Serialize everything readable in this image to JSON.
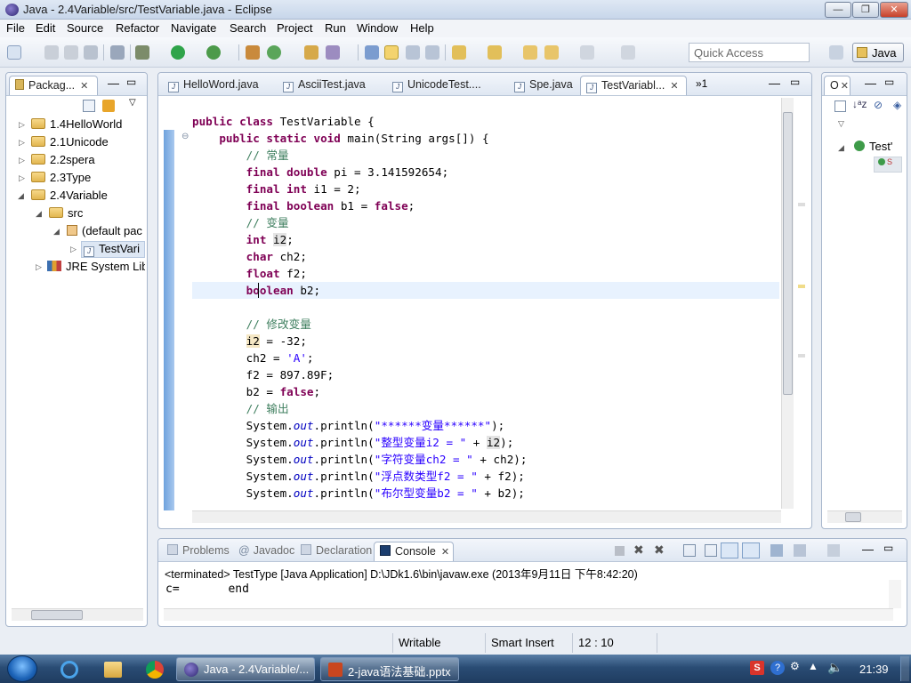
{
  "window": {
    "title": "Java - 2.4Variable/src/TestVariable.java - Eclipse"
  },
  "menu": [
    "File",
    "Edit",
    "Source",
    "Refactor",
    "Navigate",
    "Search",
    "Project",
    "Run",
    "Window",
    "Help"
  ],
  "toolbar": {
    "quick_access_placeholder": "Quick Access",
    "perspective": "Java"
  },
  "package_explorer": {
    "tab_label": "Packag...",
    "items": [
      "1.4HelloWorld",
      "2.1Unicode",
      "2.2spera",
      "2.3Type",
      "2.4Variable",
      "src",
      "(default pac",
      "TestVari",
      "JRE System Lib"
    ]
  },
  "editor": {
    "tabs": [
      "HelloWord.java",
      "AsciiTest.java",
      "UnicodeTest....",
      "Spe.java",
      "TestVariabl..."
    ],
    "overflow": "»1"
  },
  "outline": {
    "tab_label": "O",
    "item": "Test'",
    "sub": "S"
  },
  "console": {
    "tabs": [
      "Problems",
      "Javadoc",
      "Declaration",
      "Console"
    ],
    "terminated": "<terminated> TestType [Java Application] D:\\JDk1.6\\bin\\javaw.exe (2013年9月11日 下午8:42:20)",
    "output": "c=       end"
  },
  "status": {
    "writable": "Writable",
    "insert": "Smart Insert",
    "position": "12 : 10"
  },
  "taskbar": {
    "items": [
      "Java - 2.4Variable/...",
      "2-java语法基础.pptx"
    ],
    "time": "21:39"
  }
}
